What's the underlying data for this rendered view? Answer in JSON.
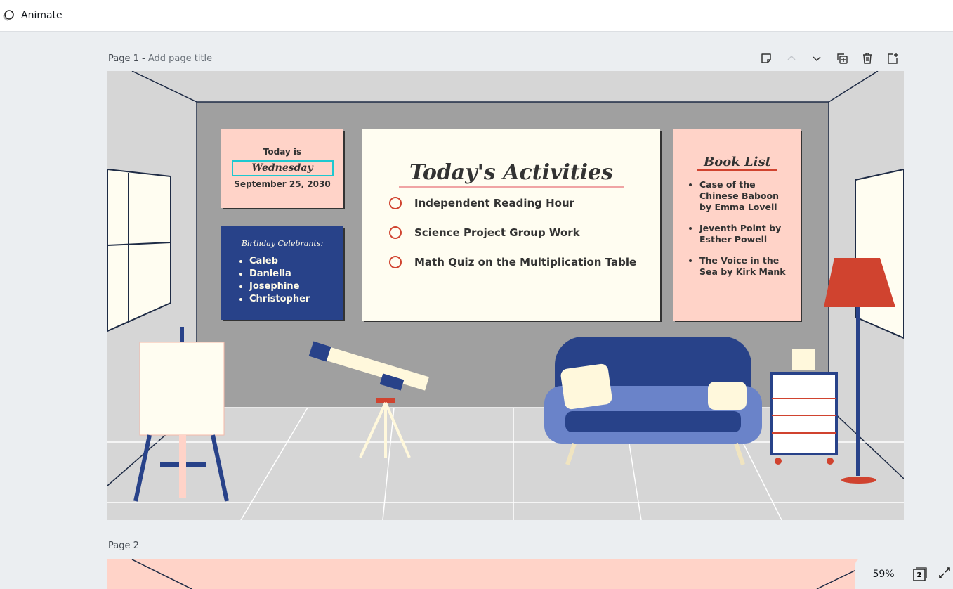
{
  "topbar": {
    "animate_label": "Animate"
  },
  "page1": {
    "label": "Page 1 - ",
    "title_placeholder": "Add page title"
  },
  "page2": {
    "label": "Page 2"
  },
  "slide": {
    "date_card": {
      "intro": "Today is",
      "day": "Wednesday",
      "date": "September 25, 2030"
    },
    "birthday_card": {
      "heading": "Birthday Celebrants:",
      "names": [
        "Caleb",
        "Daniella",
        "Josephine",
        "Christopher"
      ]
    },
    "activities_card": {
      "heading": "Today's Activities",
      "items": [
        "Independent Reading Hour",
        "Science Project Group Work",
        "Math Quiz on the Multiplication Table"
      ]
    },
    "book_card": {
      "heading": "Book List",
      "books": [
        "Case of the Chinese Baboon by Emma Lovell",
        "Jeventh Point by Esther Powell",
        "The Voice in the Sea by Kirk Mank"
      ]
    }
  },
  "footer": {
    "zoom": "59%",
    "page_count": "2"
  },
  "colors": {
    "navy": "#284289",
    "pink": "#ffd3c8",
    "cream": "#fffdf1",
    "red": "#d0432f",
    "wall": "#a0a0a0"
  }
}
